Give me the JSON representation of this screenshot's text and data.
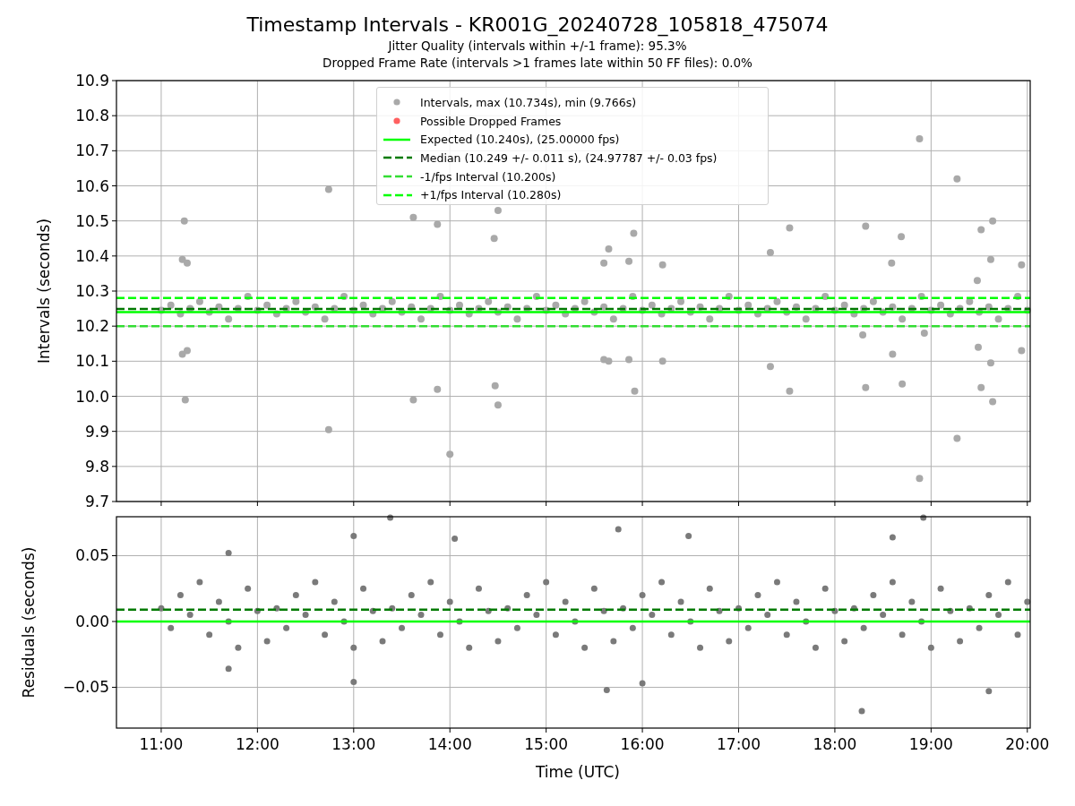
{
  "figure": {
    "title": "Timestamp Intervals - KR001G_20240728_105818_475074",
    "subtitles": [
      "Jitter Quality (intervals within +/-1 frame): 95.3%",
      "Dropped Frame Rate (intervals >1 frames late within 50 FF files): 0.0%"
    ]
  },
  "intervals_plot": {
    "legend": [
      {
        "label": "Intervals, max (10.734s), min (9.766s)",
        "kind": "marker",
        "color": "#a9a9a9"
      },
      {
        "label": "Possible Dropped Frames",
        "kind": "marker",
        "color": "#ff6060"
      },
      {
        "label": "Expected (10.240s), (25.00000 fps)",
        "kind": "solid",
        "color": "#00ff00"
      },
      {
        "label": "Median (10.249 +/- 0.011 s), (24.97787 +/- 0.03 fps)",
        "kind": "dashed",
        "color": "#007a00"
      },
      {
        "label": "-1/fps Interval (10.200s)",
        "kind": "dashed",
        "color": "#33dd33"
      },
      {
        "label": "+1/fps Interval (10.280s)",
        "kind": "dashed",
        "color": "#00ff00"
      }
    ],
    "chart_data": {
      "type": "scatter",
      "ylabel": "Intervals (seconds)",
      "xlim": [
        10.535,
        20.03
      ],
      "ylim": [
        9.7,
        10.9
      ],
      "grid": true,
      "yticks": [
        {
          "value": 9.7,
          "label": "9.7"
        },
        {
          "value": 9.8,
          "label": "9.8"
        },
        {
          "value": 9.9,
          "label": "9.9"
        },
        {
          "value": 10.0,
          "label": "10.0"
        },
        {
          "value": 10.1,
          "label": "10.1"
        },
        {
          "value": 10.2,
          "label": "10.2"
        },
        {
          "value": 10.3,
          "label": "10.3"
        },
        {
          "value": 10.4,
          "label": "10.4"
        },
        {
          "value": 10.5,
          "label": "10.5"
        },
        {
          "value": 10.6,
          "label": "10.6"
        },
        {
          "value": 10.7,
          "label": "10.7"
        },
        {
          "value": 10.8,
          "label": "10.8"
        },
        {
          "value": 10.9,
          "label": "10.9"
        }
      ],
      "ref_lines": [
        {
          "axis": "y",
          "value": 10.24
        },
        {
          "axis": "y",
          "value": 10.249
        },
        {
          "axis": "y",
          "value": 10.2
        },
        {
          "axis": "y",
          "value": 10.28
        }
      ],
      "series": [
        {
          "color": "#a9a9a9",
          "x": [
            11.0,
            11.1,
            11.2,
            11.3,
            11.4,
            11.5,
            11.6,
            11.7,
            11.8,
            11.9,
            12.0,
            12.1,
            12.2,
            12.3,
            12.4,
            12.5,
            12.6,
            12.7,
            12.8,
            12.9,
            13.0,
            13.1,
            13.2,
            13.3,
            13.4,
            13.5,
            13.6,
            13.7,
            13.8,
            13.9,
            14.0,
            14.1,
            14.2,
            14.3,
            14.4,
            14.5,
            14.6,
            14.7,
            14.8,
            14.9,
            15.0,
            15.1,
            15.2,
            15.3,
            15.4,
            15.5,
            15.6,
            15.7,
            15.8,
            15.9,
            16.0,
            16.1,
            16.2,
            16.3,
            16.4,
            16.5,
            16.6,
            16.7,
            16.8,
            16.9,
            17.0,
            17.1,
            17.2,
            17.3,
            17.4,
            17.5,
            17.6,
            17.7,
            17.8,
            17.9,
            18.0,
            18.1,
            18.2,
            18.3,
            18.4,
            18.5,
            18.6,
            18.7,
            18.8,
            18.9,
            19.0,
            19.1,
            19.2,
            19.3,
            19.4,
            19.5,
            19.6,
            19.7,
            19.8,
            19.9,
            20.0,
            11.24,
            11.22,
            11.27,
            11.22,
            11.27,
            11.25,
            12.74,
            12.74,
            13.62,
            13.62,
            13.87,
            13.87,
            14.0,
            14.5,
            14.46,
            14.47,
            14.5,
            15.65,
            15.91,
            15.6,
            15.86,
            15.6,
            15.65,
            15.86,
            15.92,
            16.21,
            16.21,
            17.33,
            17.33,
            17.53,
            17.53,
            18.32,
            18.32,
            18.29,
            18.59,
            18.6,
            18.69,
            18.7,
            18.88,
            18.88,
            18.93,
            19.27,
            19.27,
            19.52,
            19.49,
            19.52,
            19.64,
            19.62,
            19.62,
            19.64,
            19.94,
            19.94,
            19.48
          ],
          "values": [
            10.245,
            10.26,
            10.235,
            10.25,
            10.27,
            10.24,
            10.255,
            10.22,
            10.25,
            10.285,
            10.245,
            10.26,
            10.235,
            10.25,
            10.27,
            10.24,
            10.255,
            10.22,
            10.25,
            10.285,
            10.245,
            10.26,
            10.235,
            10.25,
            10.27,
            10.24,
            10.255,
            10.22,
            10.25,
            10.285,
            10.245,
            10.26,
            10.235,
            10.25,
            10.27,
            10.24,
            10.255,
            10.22,
            10.25,
            10.285,
            10.245,
            10.26,
            10.235,
            10.25,
            10.27,
            10.24,
            10.255,
            10.22,
            10.25,
            10.285,
            10.245,
            10.26,
            10.235,
            10.25,
            10.27,
            10.24,
            10.255,
            10.22,
            10.25,
            10.285,
            10.245,
            10.26,
            10.235,
            10.25,
            10.27,
            10.24,
            10.255,
            10.22,
            10.25,
            10.285,
            10.245,
            10.26,
            10.235,
            10.25,
            10.27,
            10.24,
            10.255,
            10.22,
            10.25,
            10.285,
            10.245,
            10.26,
            10.235,
            10.25,
            10.27,
            10.24,
            10.255,
            10.22,
            10.25,
            10.285,
            10.245,
            10.5,
            10.39,
            10.38,
            10.12,
            10.13,
            9.99,
            10.59,
            9.905,
            10.51,
            9.99,
            10.49,
            10.02,
            9.835,
            10.53,
            10.45,
            10.03,
            9.975,
            10.42,
            10.465,
            10.38,
            10.385,
            10.105,
            10.1,
            10.105,
            10.015,
            10.375,
            10.1,
            10.41,
            10.085,
            10.48,
            10.015,
            10.485,
            10.025,
            10.175,
            10.38,
            10.12,
            10.455,
            10.035,
            10.734,
            9.766,
            10.18,
            10.62,
            9.88,
            10.475,
            10.14,
            10.025,
            10.5,
            10.39,
            10.095,
            9.985,
            10.375,
            10.13,
            10.33
          ]
        }
      ]
    }
  },
  "residuals_plot": {
    "chart_data": {
      "type": "scatter",
      "xlabel": "Time (UTC)",
      "ylabel": "Residuals (seconds)",
      "xlim": [
        10.535,
        20.03
      ],
      "ylim": [
        -0.081,
        0.0796
      ],
      "xticks": [
        {
          "value": 11,
          "label": "11:00"
        },
        {
          "value": 12,
          "label": "12:00"
        },
        {
          "value": 13,
          "label": "13:00"
        },
        {
          "value": 14,
          "label": "14:00"
        },
        {
          "value": 15,
          "label": "15:00"
        },
        {
          "value": 16,
          "label": "16:00"
        },
        {
          "value": 17,
          "label": "17:00"
        },
        {
          "value": 18,
          "label": "18:00"
        },
        {
          "value": 19,
          "label": "19:00"
        },
        {
          "value": 20,
          "label": "20:00"
        }
      ],
      "yticks": [
        {
          "value": -0.05,
          "label": "−0.05"
        },
        {
          "value": 0,
          "label": "0.00"
        },
        {
          "value": 0.05,
          "label": "0.05"
        }
      ],
      "grid": true,
      "ref_lines": [
        {
          "axis": "y",
          "value": 0
        },
        {
          "axis": "y",
          "value": 0.009
        }
      ],
      "series": [
        {
          "color": "#7a7a7a",
          "x": [
            11.0,
            11.1,
            11.2,
            11.3,
            11.4,
            11.5,
            11.6,
            11.7,
            11.8,
            11.9,
            12.0,
            12.1,
            12.2,
            12.3,
            12.4,
            12.5,
            12.6,
            12.7,
            12.8,
            12.9,
            13.0,
            13.1,
            13.2,
            13.3,
            13.4,
            13.5,
            13.6,
            13.7,
            13.8,
            13.9,
            14.0,
            14.1,
            14.2,
            14.3,
            14.4,
            14.5,
            14.6,
            14.7,
            14.8,
            14.9,
            15.0,
            15.1,
            15.2,
            15.3,
            15.4,
            15.5,
            15.6,
            15.7,
            15.8,
            15.9,
            16.0,
            16.1,
            16.2,
            16.3,
            16.4,
            16.5,
            16.6,
            16.7,
            16.8,
            16.9,
            17.0,
            17.1,
            17.2,
            17.3,
            17.4,
            17.5,
            17.6,
            17.7,
            17.8,
            17.9,
            18.0,
            18.1,
            18.2,
            18.3,
            18.4,
            18.5,
            18.6,
            18.7,
            18.8,
            18.9,
            19.0,
            19.1,
            19.2,
            19.3,
            19.4,
            19.5,
            19.6,
            19.7,
            19.8,
            19.9,
            20.0,
            13.0,
            13.38,
            18.28,
            18.92,
            15.63,
            19.6,
            16.48,
            11.7,
            11.7,
            15.75,
            13.0,
            16.0,
            14.05,
            18.6
          ],
          "values": [
            0.01,
            -0.005,
            0.02,
            0.005,
            0.03,
            -0.01,
            0.015,
            0.0,
            -0.02,
            0.025,
            0.008,
            -0.015,
            0.01,
            -0.005,
            0.02,
            0.005,
            0.03,
            -0.01,
            0.015,
            0.0,
            -0.02,
            0.025,
            0.008,
            -0.015,
            0.01,
            -0.005,
            0.02,
            0.005,
            0.03,
            -0.01,
            0.015,
            0.0,
            -0.02,
            0.025,
            0.008,
            -0.015,
            0.01,
            -0.005,
            0.02,
            0.005,
            0.03,
            -0.01,
            0.015,
            0.0,
            -0.02,
            0.025,
            0.008,
            -0.015,
            0.01,
            -0.005,
            0.02,
            0.005,
            0.03,
            -0.01,
            0.015,
            0.0,
            -0.02,
            0.025,
            0.008,
            -0.015,
            0.01,
            -0.005,
            0.02,
            0.005,
            0.03,
            -0.01,
            0.015,
            0.0,
            -0.02,
            0.025,
            0.008,
            -0.015,
            0.01,
            -0.005,
            0.02,
            0.005,
            0.03,
            -0.01,
            0.015,
            0.0,
            -0.02,
            0.025,
            0.008,
            -0.015,
            0.01,
            -0.005,
            0.02,
            0.005,
            0.03,
            -0.01,
            0.015,
            0.065,
            0.079,
            -0.068,
            0.079,
            -0.052,
            -0.053,
            0.065,
            0.052,
            -0.036,
            0.07,
            -0.046,
            -0.047,
            0.063,
            0.064
          ]
        }
      ]
    }
  }
}
